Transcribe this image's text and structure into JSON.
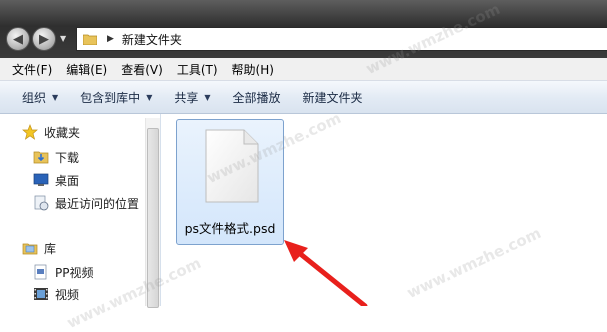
{
  "address": {
    "path": "新建文件夹"
  },
  "menu": [
    "文件(F)",
    "编辑(E)",
    "查看(V)",
    "工具(T)",
    "帮助(H)"
  ],
  "toolbar": [
    {
      "label": "组织",
      "dropdown": true
    },
    {
      "label": "包含到库中",
      "dropdown": true
    },
    {
      "label": "共享",
      "dropdown": true
    },
    {
      "label": "全部播放",
      "dropdown": false
    },
    {
      "label": "新建文件夹",
      "dropdown": false
    }
  ],
  "nav": {
    "favorites": "收藏夹",
    "downloads": "下载",
    "desktop": "桌面",
    "recent": "最近访问的位置",
    "libraries": "库",
    "pp_video": "PP视频",
    "video": "视频"
  },
  "file": {
    "name": "ps文件格式.psd"
  },
  "watermark": "www.wmzhe.com",
  "colors": {
    "arrow": "#e8201c",
    "selection": "#d3e6fb",
    "selection_border": "#7da2ce"
  }
}
